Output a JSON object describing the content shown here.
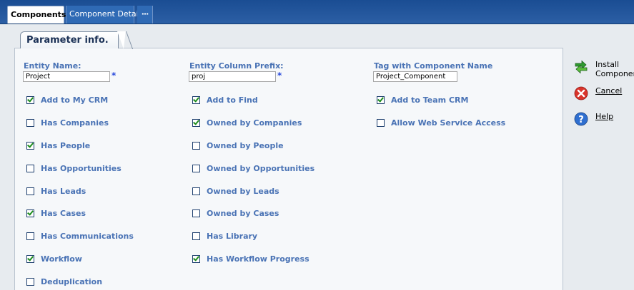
{
  "tabs": {
    "components": "Components",
    "component_details": "Component Details",
    "more": "···"
  },
  "panel": {
    "tab_title": "Parameter info."
  },
  "fields": {
    "entity_name": {
      "label": "Entity Name:",
      "value": "Project",
      "required": "*"
    },
    "entity_column_prefix": {
      "label": "Entity Column Prefix:",
      "value": "proj",
      "required": "*"
    },
    "tag_component": {
      "label": "Tag with Component Name",
      "value": "Project_Component"
    }
  },
  "checkboxes": {
    "col1": [
      {
        "label": "Add to My CRM",
        "checked": true
      },
      {
        "label": "Has Companies",
        "checked": false
      },
      {
        "label": "Has People",
        "checked": true
      },
      {
        "label": "Has Opportunities",
        "checked": false
      },
      {
        "label": "Has Leads",
        "checked": false
      },
      {
        "label": "Has Cases",
        "checked": true
      },
      {
        "label": "Has Communications",
        "checked": false
      },
      {
        "label": "Workflow",
        "checked": true
      },
      {
        "label": "Deduplication",
        "checked": false
      }
    ],
    "col2": [
      {
        "label": "Add to Find",
        "checked": true
      },
      {
        "label": "Owned by Companies",
        "checked": true
      },
      {
        "label": "Owned by People",
        "checked": false
      },
      {
        "label": "Owned by Opportunities",
        "checked": false
      },
      {
        "label": "Owned by Leads",
        "checked": false
      },
      {
        "label": "Owned by Cases",
        "checked": false
      },
      {
        "label": "Has Library",
        "checked": false
      },
      {
        "label": "Has Workflow Progress",
        "checked": true
      }
    ],
    "col3": [
      {
        "label": "Add to Team CRM",
        "checked": true
      },
      {
        "label": "Allow Web Service Access",
        "checked": false
      }
    ]
  },
  "actions": {
    "install": "Install\nComponent",
    "cancel": "Cancel",
    "help": "Help"
  },
  "colors": {
    "topbar": "#2c5fa5",
    "label": "#4a73b5",
    "required": "#2a4bdc",
    "checkmark": "#1b8c1b"
  },
  "icons": {
    "install": "green-arrows-icon",
    "cancel": "red-x-icon",
    "help": "blue-question-icon"
  }
}
